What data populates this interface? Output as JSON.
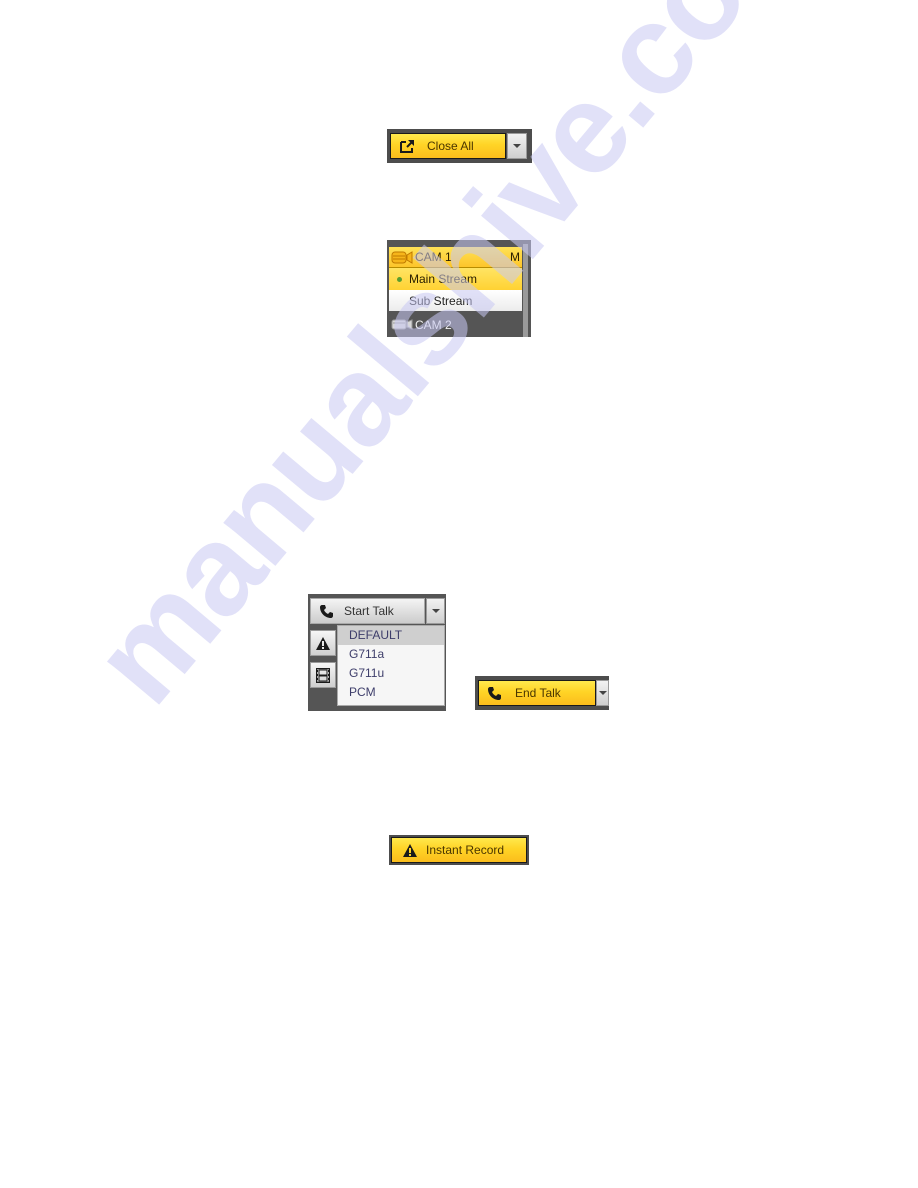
{
  "close_all": {
    "label": "Close All",
    "icon": "close-all-icon",
    "dropdown_icon": "chevron-down-icon"
  },
  "stream_list": {
    "cameras": [
      {
        "label": "CAM 1",
        "badge": "M",
        "expanded": true,
        "streams": [
          {
            "label": "Main Stream",
            "selected": true
          },
          {
            "label": "Sub Stream",
            "selected": false
          }
        ]
      },
      {
        "label": "CAM 2",
        "expanded": false
      }
    ]
  },
  "start_talk": {
    "label": "Start Talk",
    "icon": "phone-icon",
    "dropdown_icon": "chevron-down-icon",
    "side_buttons": [
      {
        "icon": "alarm-icon"
      },
      {
        "icon": "record-film-icon"
      }
    ],
    "codec_options": [
      "DEFAULT",
      "G711a",
      "G711u",
      "PCM"
    ],
    "highlighted_option": "DEFAULT"
  },
  "end_talk": {
    "label": "End Talk",
    "icon": "phone-icon",
    "dropdown_icon": "chevron-down-icon"
  },
  "instant_record": {
    "label": "Instant Record",
    "icon": "warning-icon"
  },
  "watermark": "manualshive.com",
  "colors": {
    "accent_yellow": "#ffd426",
    "frame_gray": "#4d4d4d",
    "selected_dot": "#5a9e2f"
  }
}
